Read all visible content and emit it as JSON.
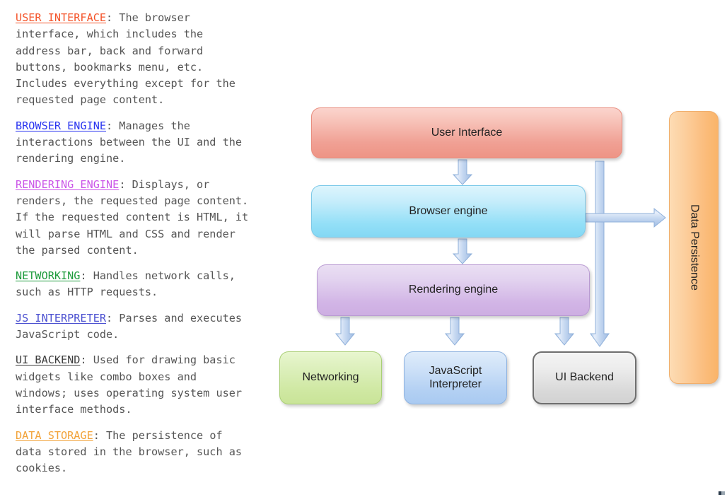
{
  "legend": {
    "entries": [
      {
        "id": "user-interface",
        "term": "USER INTERFACE",
        "color": "#f4542a",
        "description": ": The browser interface, which includes the address bar, back and forward buttons, bookmarks menu, etc. Includes everything except for the requested page content."
      },
      {
        "id": "browser-engine",
        "term": "BROWSER ENGINE",
        "color": "#2a35f0",
        "description": ": Manages the interactions between the UI and the rendering engine."
      },
      {
        "id": "rendering-engine",
        "term": "RENDERING ENGINE",
        "color": "#cb57e8",
        "description": ": Displays, or renders, the requested page content. If the requested content is HTML, it will parse HTML and CSS and render the parsed content."
      },
      {
        "id": "networking",
        "term": "NETWORKING",
        "color": "#1e9b3c",
        "description": ": Handles network calls, such as HTTP requests."
      },
      {
        "id": "js-interpreter",
        "term": "JS INTERPRETER",
        "color": "#4a4fd0",
        "description": ": Parses and executes JavaScript code."
      },
      {
        "id": "ui-backend",
        "term": "UI BACKEND",
        "color": "#3d3d3d",
        "description": ": Used for drawing basic widgets like combo boxes and windows; uses operating system user interface methods."
      },
      {
        "id": "data-storage",
        "term": "DATA STORAGE",
        "color": "#f2a33a",
        "description": ": The persistence of data stored in the browser, such as cookies."
      }
    ]
  },
  "diagram": {
    "nodes": {
      "user_interface": {
        "label": "User  Interface",
        "fill": "#f0a094"
      },
      "browser_engine": {
        "label": "Browser engine",
        "fill": "#93dff7"
      },
      "rendering_engine": {
        "label": "Rendering engine",
        "fill": "#d2b5e6"
      },
      "networking": {
        "label": "Networking",
        "fill": "#cfe8a2"
      },
      "javascript_interpreter": {
        "label": "JavaScript\nInterpreter",
        "line1": "JavaScript",
        "line2": "Interpreter",
        "fill": "#b3d0f3"
      },
      "ui_backend": {
        "label": "UI Backend",
        "fill": "#d8d8d8"
      },
      "data_persistence": {
        "label": "Data Persistence",
        "fill": "#fbbd7d"
      }
    },
    "arrows": [
      {
        "from": "user_interface",
        "to": "browser_engine"
      },
      {
        "from": "browser_engine",
        "to": "rendering_engine"
      },
      {
        "from": "rendering_engine",
        "to": "networking"
      },
      {
        "from": "rendering_engine",
        "to": "javascript_interpreter"
      },
      {
        "from": "rendering_engine",
        "to": "ui_backend"
      },
      {
        "from": "user_interface",
        "to": "ui_backend"
      },
      {
        "from": "browser_engine",
        "to": "data_persistence"
      }
    ],
    "arrow_color": "#aac4e8"
  }
}
